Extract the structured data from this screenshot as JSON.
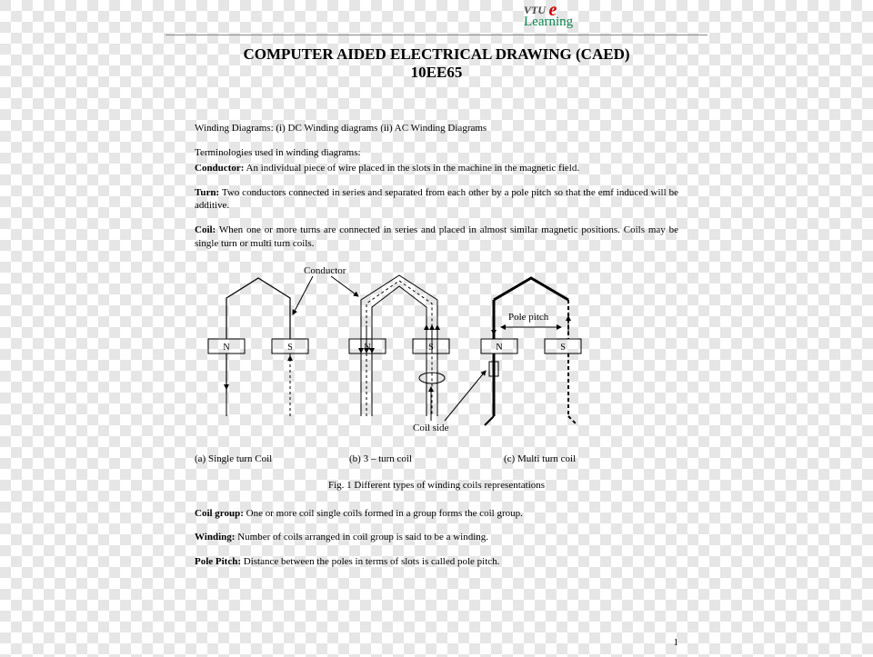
{
  "logo": {
    "vtu": "VTU",
    "e": "e",
    "learning": "Learning"
  },
  "title": "COMPUTER AIDED ELECTRICAL DRAWING (CAED)",
  "code": "10EE65",
  "intro": "Winding Diagrams: (i) DC Winding diagrams   (ii) AC Winding Diagrams",
  "termHeading": "Terminologies used in winding diagrams:",
  "defs": {
    "conductorLabel": "Conductor:",
    "conductorText": " An individual piece of wire placed in the slots in the machine in the magnetic field.",
    "turnLabel": "Turn:",
    "turnText": " Two conductors connected in series and separated from each other by a pole pitch so that the emf induced will be additive.",
    "coilLabel": "Coil:",
    "coilText": " When one or more turns are connected in series and placed in almost similar magnetic positions. Coils may be single turn or multi turn coils."
  },
  "diagramLabels": {
    "conductor": "Conductor",
    "polePitch": "Pole pitch",
    "coilSide": "Coil side",
    "N": "N",
    "S": "S"
  },
  "captions": {
    "a": "(a) Single turn Coil",
    "b": "(b) 3 – turn coil",
    "c": "(c) Multi turn coil"
  },
  "figcap": "Fig. 1 Different types of winding coils representations",
  "defs2": {
    "coilGroupLabel": "Coil group:",
    "coilGroupText": " One or more coil single coils formed in a group forms the coil group.",
    "windingLabel": "Winding:",
    "windingText": " Number of coils arranged in coil group is said to be a winding.",
    "polePitchLabel": "Pole Pitch:",
    "polePitchText": " Distance between the poles in terms of slots is called pole pitch."
  },
  "pagenum": "1"
}
